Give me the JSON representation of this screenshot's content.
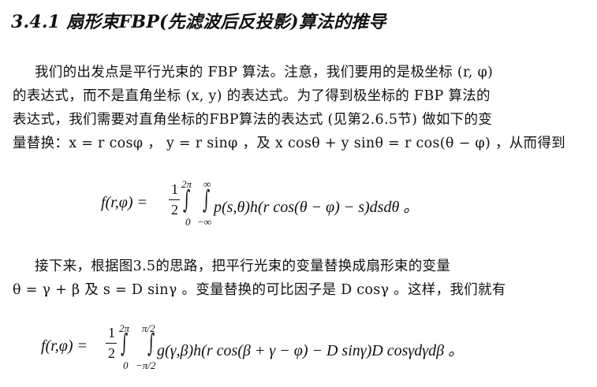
{
  "section": {
    "heading": "3.4.1 扇形束FBP(先滤波后反投影)算法的推导"
  },
  "para1": {
    "lines": [
      "我们的出发点是平行光束的 FBP 算法。注意，我们要用的是极坐标 (r, φ)",
      "的表达式，而不是直角坐标 (x, y) 的表达式。为了得到极坐标的 FBP 算法的",
      "表达式，我们需要对直角坐标的FBP算法的表达式 (见第2.6.5节) 做如下的变",
      "量替换：x = r cosφ ， y = r sinφ ，及 x cosθ + y sinθ = r cos(θ − φ) ，从而得到"
    ]
  },
  "eq1": {
    "lhs": "f(r,φ) =",
    "frac_num": "1",
    "frac_den": "2",
    "int1_upper": "2π",
    "int1_lower": "0",
    "int2_upper": "∞",
    "int2_lower": "−∞",
    "body": "p(s,θ)h(r cos(θ − φ) − s)dsdθ 。"
  },
  "para2": {
    "lines": [
      "接下来，根据图3.5的思路，把平行光束的变量替换成扇形束的变量",
      "θ = γ + β  及 s = D sinγ 。变量替换的可比因子是  D cosγ 。这样，我们就有"
    ]
  },
  "eq2": {
    "lhs": "f(r,φ) =",
    "frac_num": "1",
    "frac_den": "2",
    "int1_upper": "2π",
    "int1_lower": "0",
    "int2_upper": "π/2",
    "int2_lower": "−π/2",
    "body": "g(γ,β)h(r cos(β + γ − φ) − D sinγ)D cosγdγdβ 。"
  }
}
